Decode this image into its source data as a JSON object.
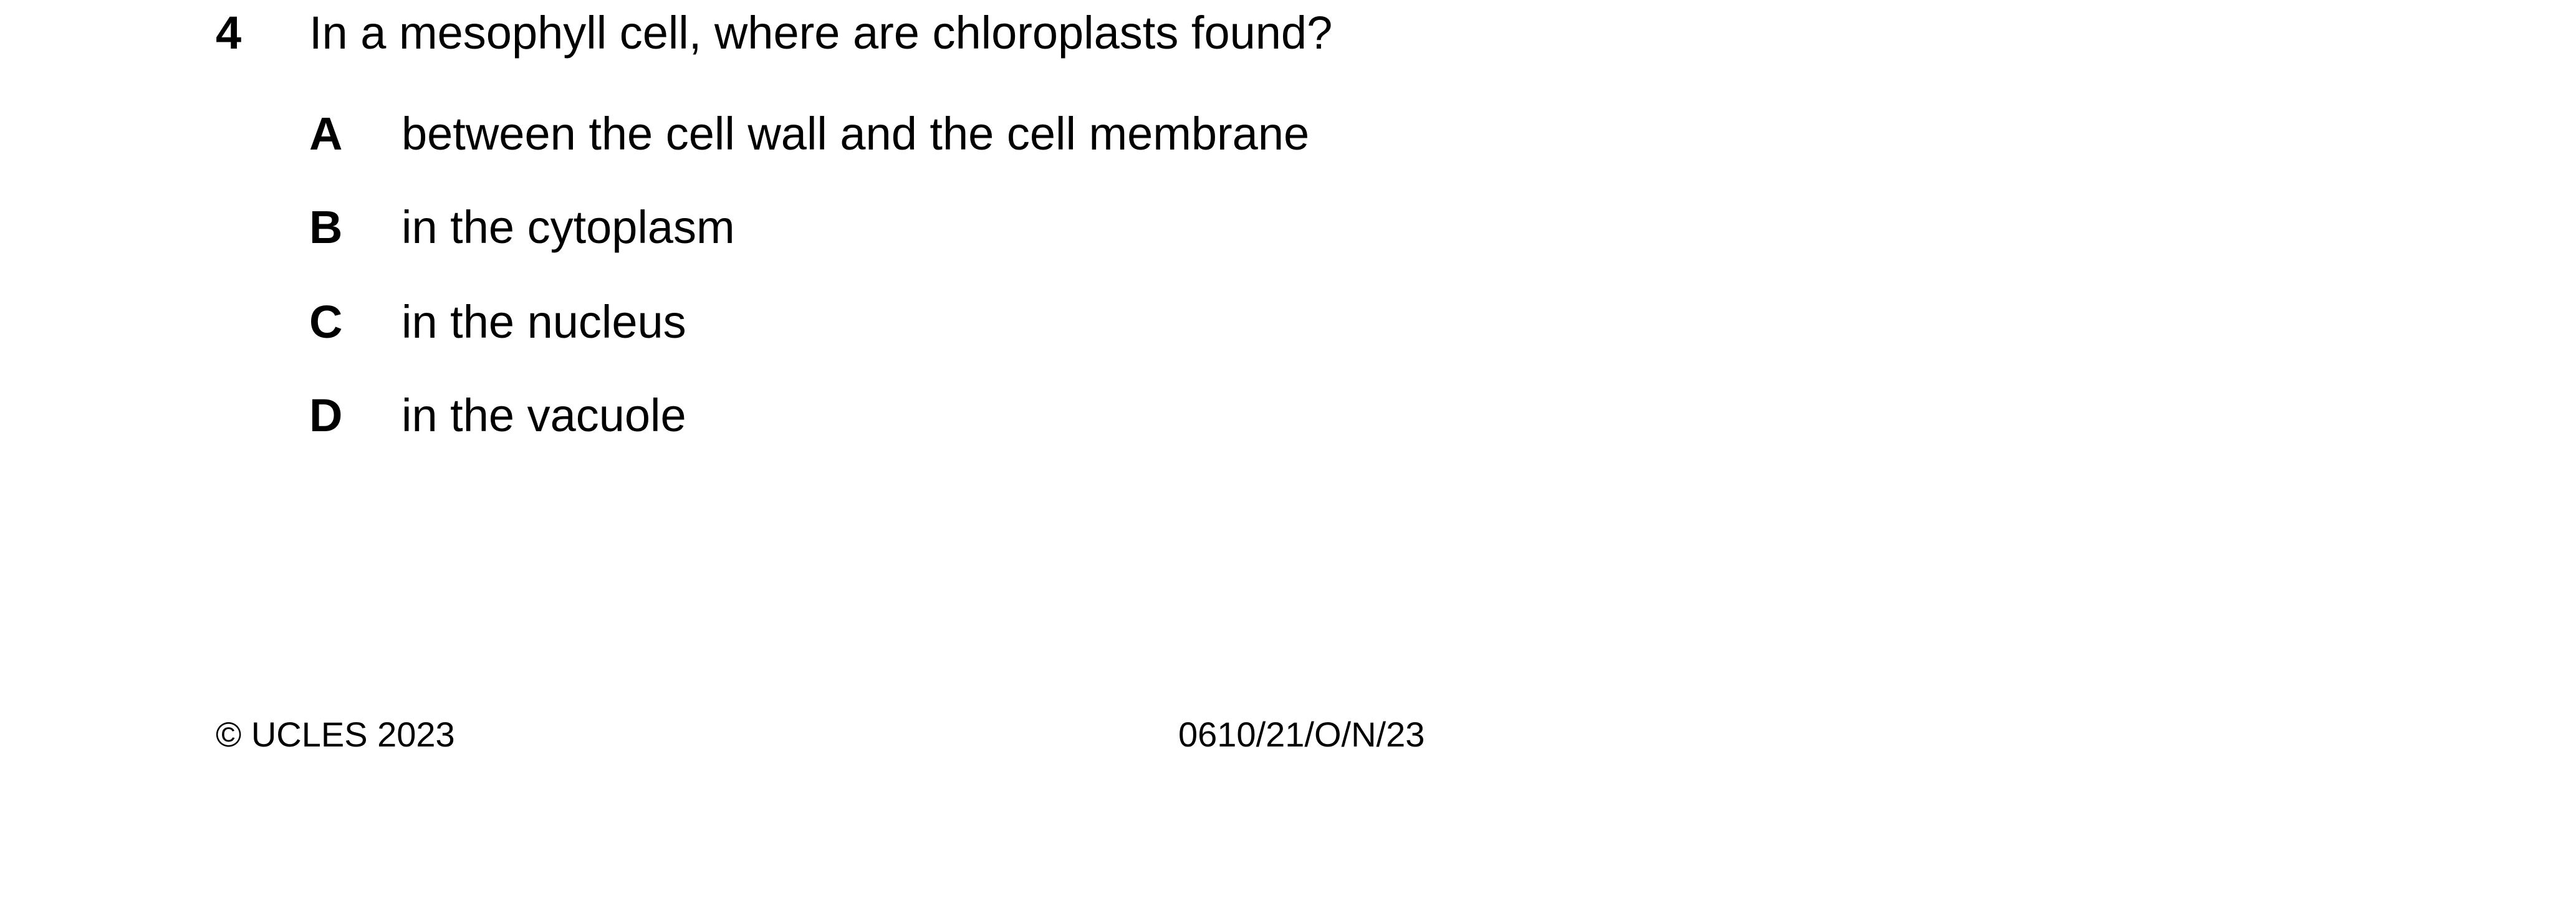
{
  "question": {
    "number": "4",
    "text": "In a mesophyll cell, where are chloroplasts found?",
    "options": [
      {
        "letter": "A",
        "text": "between the cell wall and the cell membrane"
      },
      {
        "letter": "B",
        "text": "in the cytoplasm"
      },
      {
        "letter": "C",
        "text": "in the nucleus"
      },
      {
        "letter": "D",
        "text": "in the vacuole"
      }
    ]
  },
  "footer": {
    "copyright": "© UCLES 2023",
    "paper_code": "0610/21/O/N/23"
  }
}
